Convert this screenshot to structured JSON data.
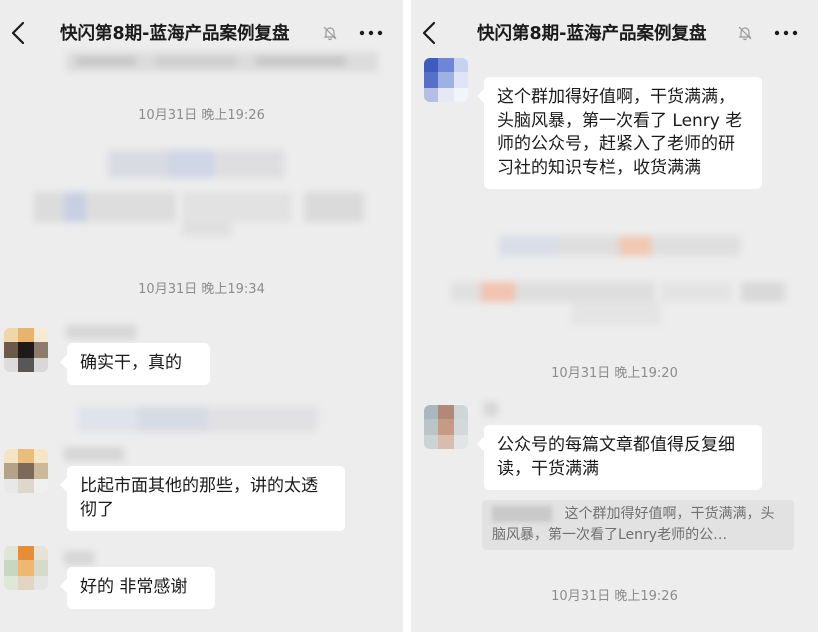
{
  "left": {
    "title": "快闪第8期-蓝海产品案例复盘",
    "timestamps": [
      "10月31日 晚上19:26",
      "10月31日 晚上19:34"
    ],
    "messages": [
      "确实干，真的",
      "比起市面其他的那些，讲的太透彻了",
      "好的 非常感谢"
    ]
  },
  "right": {
    "title": "快闪第8期-蓝海产品案例复盘",
    "timestamps": [
      "10月31日 晚上19:20",
      "10月31日 晚上19:26"
    ],
    "messages": [
      "这个群加得好值啊，干货满满，头脑风暴，第一次看了 Lenry 老师的公众号，赶紧入了老师的研习社的知识专栏，收货满满",
      "公众号的每篇文章都值得反复细读，干货满满"
    ],
    "quote": "这个群加得好值啊，干货满满，头脑风暴，第一次看了Lenry老师的公…"
  },
  "colors": {
    "background": "#ededed",
    "bubble": "#ffffff",
    "timestamp": "#8c8c8c",
    "quote_background": "#e2e2e2"
  },
  "icons": [
    "back-arrow-icon",
    "mute-bell-icon",
    "more-dots-icon"
  ]
}
